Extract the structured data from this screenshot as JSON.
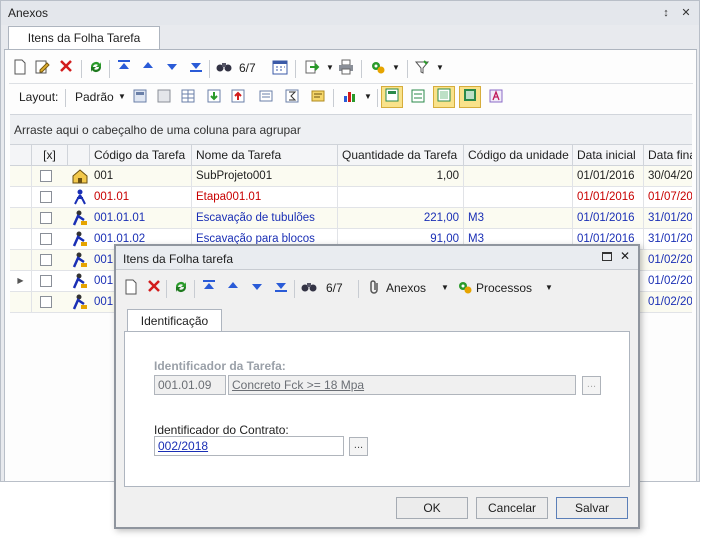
{
  "panel": {
    "title": "Anexos",
    "pin_glyph": "↕",
    "close_glyph": "✕"
  },
  "tab": {
    "label": "Itens da Folha Tarefa"
  },
  "toolbar1": {
    "counter": "6/7"
  },
  "toolbar2": {
    "layout_label": "Layout:",
    "layout_value": "Padrão"
  },
  "grid": {
    "group_hint": "Arraste aqui o cabeçalho de uma coluna para agrupar",
    "headers": [
      "[x]",
      "Código da Tarefa",
      "Nome da Tarefa",
      "Quantidade da Tarefa",
      "Código da unidade",
      "Data inicial",
      "Data fina"
    ],
    "rows": [
      {
        "code": "001",
        "name": "SubProjeto001",
        "qty": "1,00",
        "unit": "",
        "start": "01/01/2016",
        "end": "30/04/20",
        "color": "#1e1e1e"
      },
      {
        "code": "001.01",
        "name": "Etapa001.01",
        "qty": "",
        "unit": "",
        "start": "01/01/2016",
        "end": "01/07/20",
        "color": "#c80000"
      },
      {
        "code": "001.01.01",
        "name": "Escavação de tubulões",
        "qty": "221,00",
        "unit": "M3",
        "start": "01/01/2016",
        "end": "31/01/20",
        "color": "#1a2fb5"
      },
      {
        "code": "001.01.02",
        "name": "Escavação para blocos",
        "qty": "91,00",
        "unit": "M3",
        "start": "01/01/2016",
        "end": "31/01/20",
        "color": "#1a2fb5"
      },
      {
        "code": "001.",
        "name": "",
        "qty": "",
        "unit": "",
        "start": "",
        "end": "01/02/20",
        "color": "#1a2fb5"
      },
      {
        "code": "001.",
        "name": "",
        "qty": "",
        "unit": "",
        "start": "",
        "end": "01/02/20",
        "color": "#1a2fb5"
      },
      {
        "code": "001.",
        "name": "",
        "qty": "",
        "unit": "",
        "start": "",
        "end": "01/02/20",
        "color": "#1a2fb5"
      }
    ]
  },
  "dialog": {
    "title": "Itens da Folha tarefa",
    "counter": "6/7",
    "anexos_label": "Anexos",
    "processos_label": "Processos",
    "tab_label": "Identificação",
    "task_id_label": "Identificador da Tarefa:",
    "task_id_code": "001.01.09",
    "task_id_desc": "Concreto Fck >= 18 Mpa",
    "contract_label": "Identificador do Contrato:",
    "contract_value": "002/2018",
    "ellipsis": "...",
    "ok": "OK",
    "cancel": "Cancelar",
    "save": "Salvar"
  }
}
